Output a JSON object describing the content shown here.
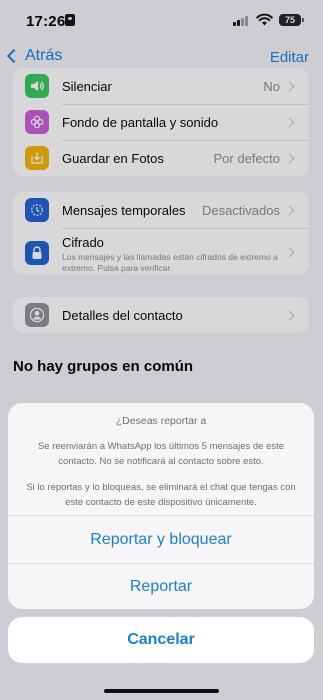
{
  "status_bar": {
    "time": "17:26",
    "battery": "75"
  },
  "nav": {
    "back_label": "Atrás",
    "edit_label": "Editar"
  },
  "group1": [
    {
      "label": "Silenciar",
      "value": "No",
      "icon": "speaker-icon",
      "color": "#34c759"
    },
    {
      "label": "Fondo de pantalla y sonido",
      "value": "",
      "icon": "flower-icon",
      "color": "#c85bd6"
    },
    {
      "label": "Guardar en Fotos",
      "value": "Por defecto",
      "icon": "save-download-icon",
      "color": "#f4b400"
    }
  ],
  "group2": {
    "temporales": {
      "label": "Mensajes temporales",
      "value": "Desactivados",
      "icon": "timer-icon",
      "color": "#1e5fcf"
    },
    "cifrado": {
      "label": "Cifrado",
      "subtitle": "Los mensajes y las llamadas están cifrados de extremo a extremo. Pulsa para verificar.",
      "icon": "lock-icon",
      "color": "#1e5fcf"
    }
  },
  "group3": {
    "label": "Detalles del contacto",
    "icon": "person-circle-icon",
    "color": "#8e8e93"
  },
  "section_title": "No hay grupos en común",
  "action_sheet": {
    "title": "¿Deseas reportar a",
    "message1": "Se reenviarán a WhatsApp los últimos 5 mensajes de este contacto. No se notificará al contacto sobre esto.",
    "message2": "Si lo reportas y lo bloqueas, se eliminará el chat que tengas con este contacto de este dispositivo únicamente.",
    "report_block_label": "Reportar y bloquear",
    "report_label": "Reportar",
    "cancel_label": "Cancelar"
  },
  "colors": {
    "accent": "#1a7fd9",
    "background": "#f2f2f7"
  }
}
